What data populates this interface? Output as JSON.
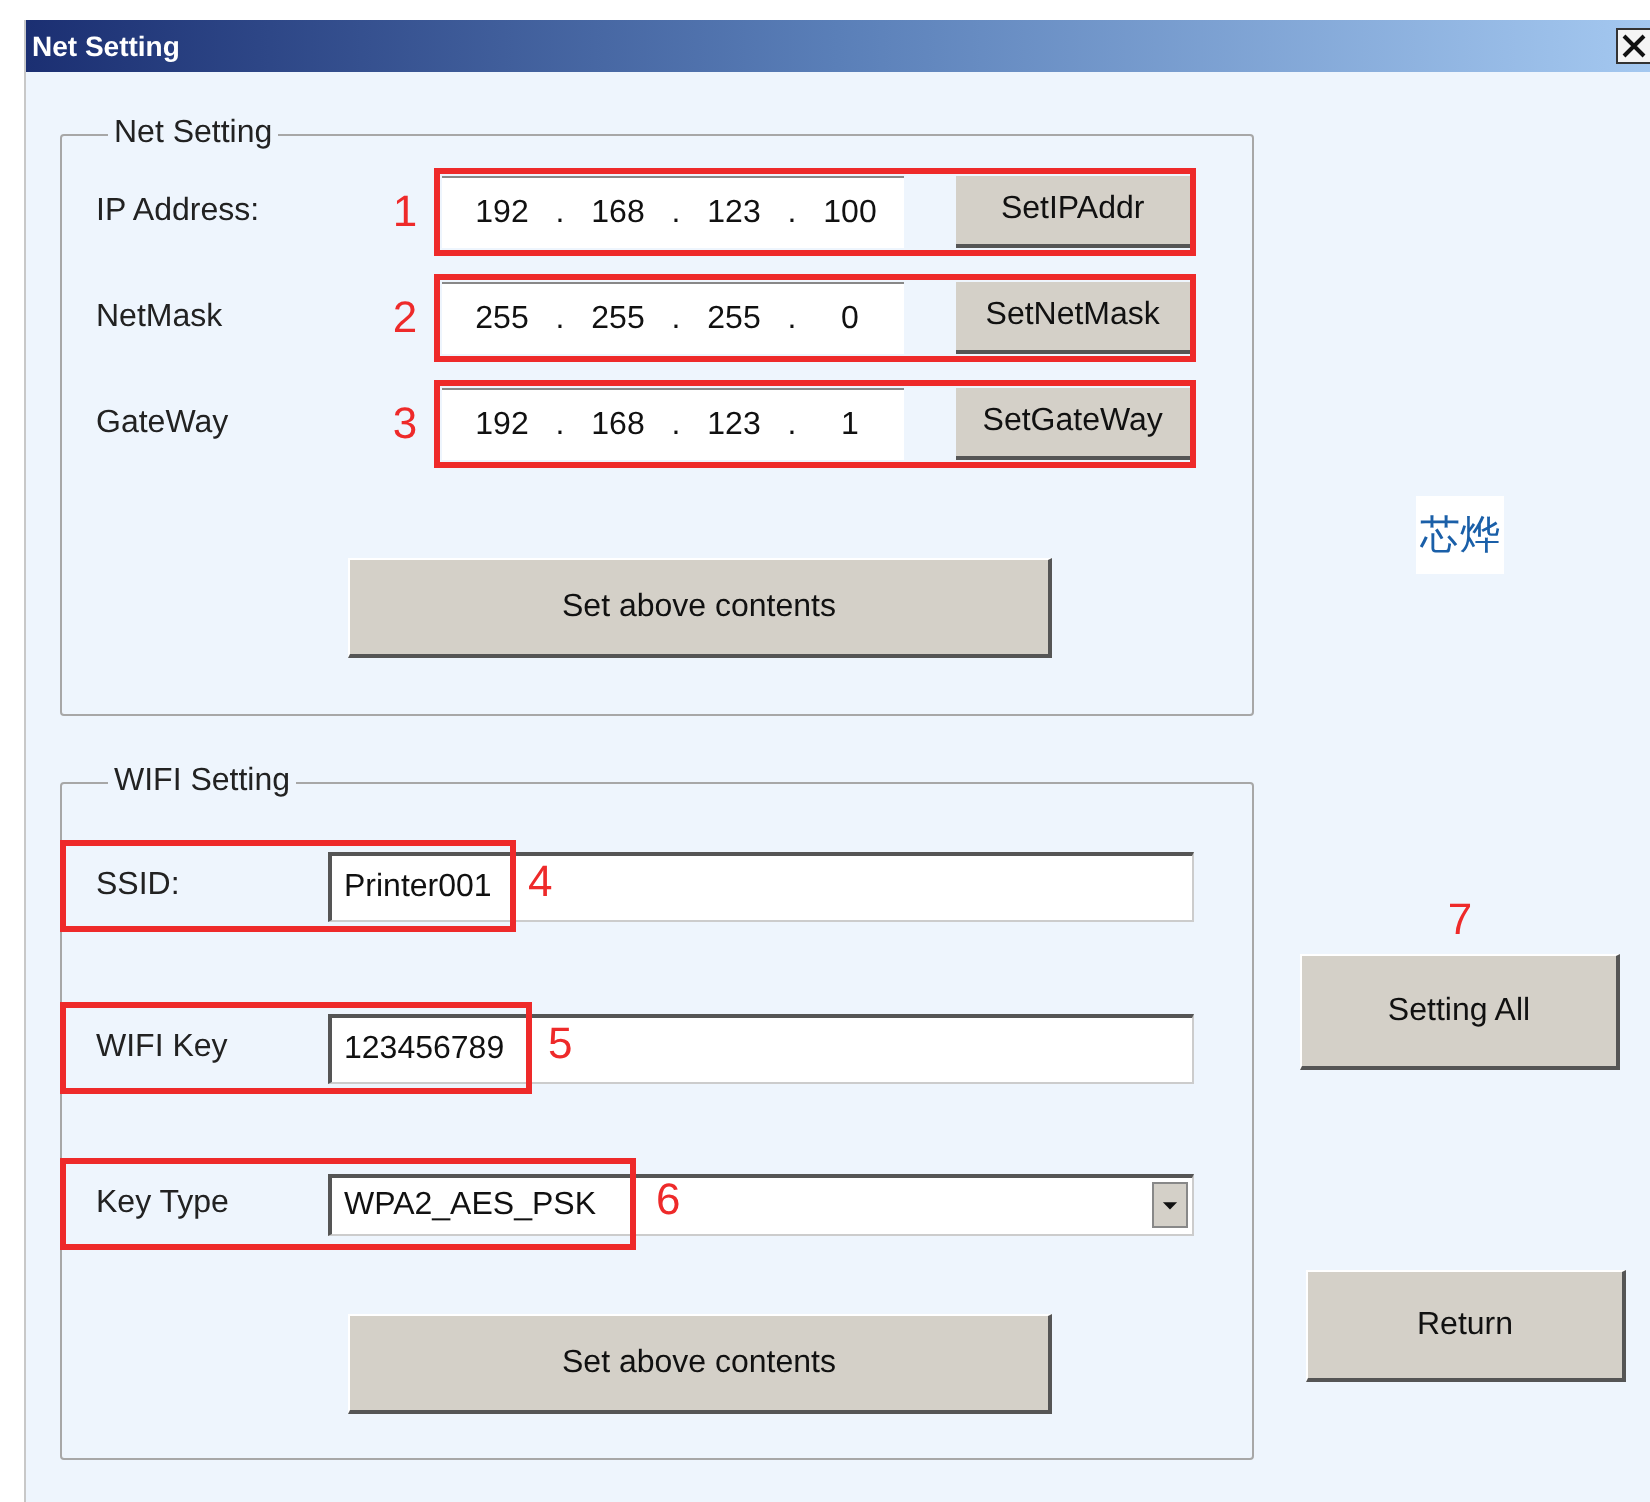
{
  "window": {
    "title": "Net Setting"
  },
  "net_setting": {
    "title": "Net Setting",
    "separator": ".",
    "rows": [
      {
        "label": "IP Address:",
        "callout": "1",
        "octets": [
          "192",
          "168",
          "123",
          "100"
        ],
        "button": "SetIPAddr"
      },
      {
        "label": "NetMask",
        "callout": "2",
        "octets": [
          "255",
          "255",
          "255",
          "0"
        ],
        "button": "SetNetMask"
      },
      {
        "label": "GateWay",
        "callout": "3",
        "octets": [
          "192",
          "168",
          "123",
          "1"
        ],
        "button": "SetGateWay"
      }
    ],
    "button": "Set above contents"
  },
  "wifi_setting": {
    "title": "WIFI Setting",
    "rows": [
      {
        "kind": "text",
        "label": "SSID:",
        "value": "Printer001",
        "callout": "4"
      },
      {
        "kind": "text",
        "label": "WIFI Key",
        "value": "123456789",
        "callout": "5"
      },
      {
        "kind": "dropdown",
        "label": "Key Type",
        "value": "WPA2_AES_PSK",
        "callout": "6"
      }
    ],
    "button": "Set above contents"
  },
  "side": {
    "logo": "芯烨",
    "setting_all": {
      "label": "Setting All",
      "callout": "7"
    },
    "return_button": "Return"
  }
}
